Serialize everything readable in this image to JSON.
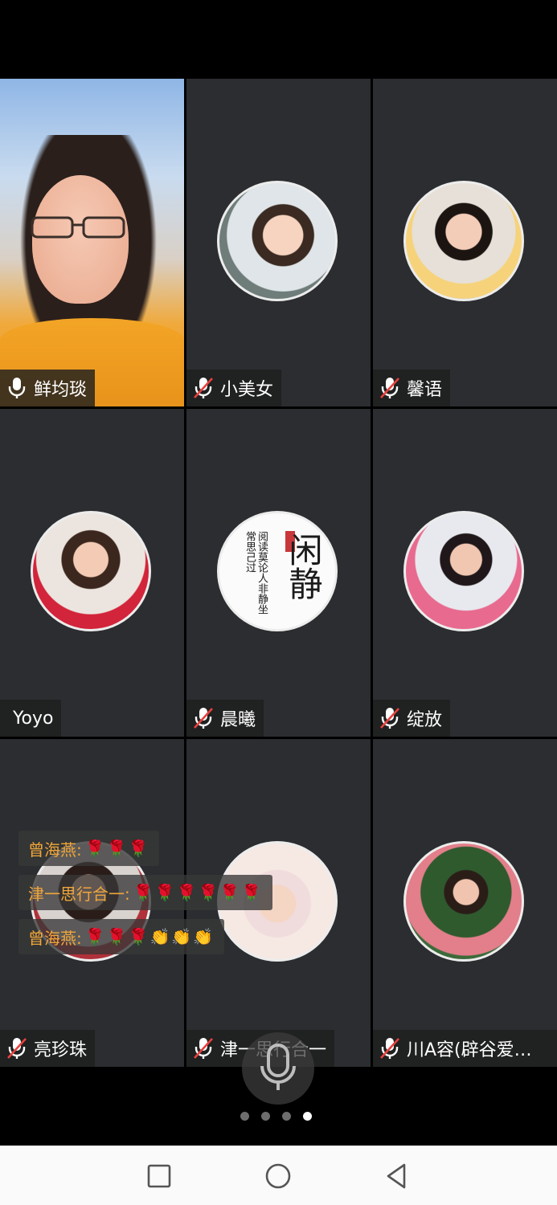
{
  "participants": [
    {
      "name": "鲜均琰",
      "mic": "on"
    },
    {
      "name": "小美女",
      "mic": "muted"
    },
    {
      "name": "馨语",
      "mic": "muted"
    },
    {
      "name": "Yoyo",
      "mic": "none"
    },
    {
      "name": "晨曦",
      "mic": "muted"
    },
    {
      "name": "绽放",
      "mic": "muted"
    },
    {
      "name": "亮珍珠",
      "mic": "muted"
    },
    {
      "name": "津一思行合一",
      "mic": "muted"
    },
    {
      "name": "川A容(辟谷爱…",
      "mic": "muted"
    }
  ],
  "calligraphy": {
    "big": "闲静",
    "small": "阅读莫论人非静坐常思己过"
  },
  "chat_messages": [
    {
      "sender": "曾海燕:",
      "emoji": "🌹🌹🌹"
    },
    {
      "sender": "津一思行合一:",
      "emoji": "🌹🌹🌹🌹🌹🌹"
    },
    {
      "sender": "曾海燕:",
      "emoji": "🌹🌹🌹👏👏👏"
    }
  ],
  "pager": {
    "count": 4,
    "active_index": 3
  },
  "icons": {
    "mic_button": "microphone-icon",
    "nav": [
      "recent-apps-icon",
      "home-icon",
      "back-icon"
    ]
  },
  "colors": {
    "tile_bg": "#2b2d30",
    "chat_text": "#f0a63a",
    "mute_slash": "#e8413d"
  }
}
